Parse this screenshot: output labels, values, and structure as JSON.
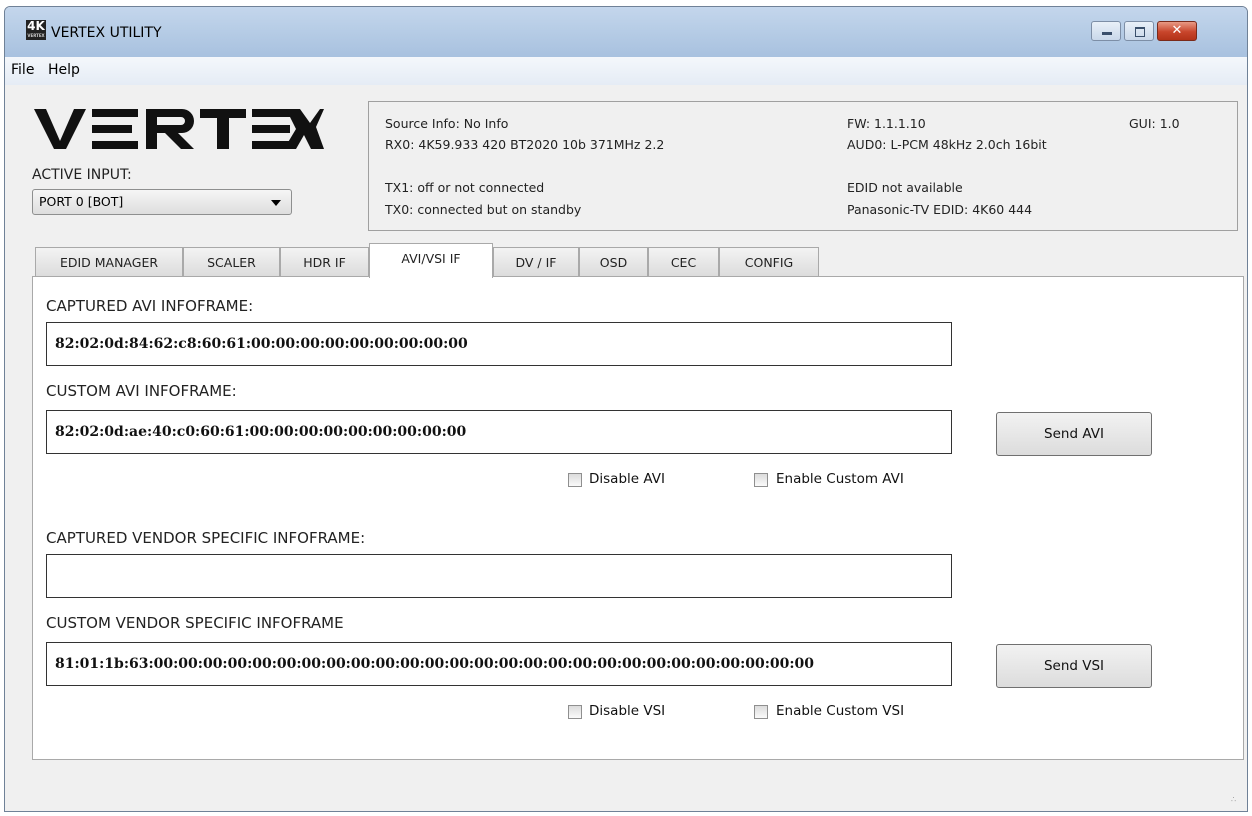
{
  "window": {
    "title": "VERTEX UTILITY",
    "app_icon": "4K-icon"
  },
  "menu": {
    "file": "File",
    "help": "Help"
  },
  "logo": {
    "text": "VERTEX"
  },
  "active_input": {
    "label": "ACTIVE INPUT:",
    "value": "PORT 0 [BOT]"
  },
  "info": {
    "source": "Source Info: No Info",
    "rx0": "RX0: 4K59.933 420 BT2020 10b 371MHz 2.2",
    "tx1": "TX1: off or not connected",
    "tx0": "TX0: connected but on standby",
    "fw": "FW: 1.1.1.10",
    "gui": "GUI: 1.0",
    "aud0": "AUD0: L-PCM 48kHz 2.0ch 16bit",
    "edid_status": "EDID not available",
    "edid_tv": "Panasonic-TV EDID: 4K60 444"
  },
  "tabs": [
    "EDID MANAGER",
    "SCALER",
    "HDR IF",
    "AVI/VSI IF",
    "DV / IF",
    "OSD",
    "CEC",
    "CONFIG"
  ],
  "panel": {
    "captured_avi_label": "CAPTURED AVI INFOFRAME:",
    "captured_avi_value": "82:02:0d:84:62:c8:60:61:00:00:00:00:00:00:00:00:00",
    "custom_avi_label": "CUSTOM AVI INFOFRAME:",
    "custom_avi_value": "82:02:0d:ae:40:c0:60:61:00:00:00:00:00:00:00:00:00",
    "send_avi": "Send AVI",
    "disable_avi": "Disable AVI",
    "enable_custom_avi": "Enable Custom AVI",
    "captured_vsi_label": "CAPTURED VENDOR SPECIFIC INFOFRAME:",
    "captured_vsi_value": "",
    "custom_vsi_label": "CUSTOM VENDOR SPECIFIC INFOFRAME",
    "custom_vsi_value": "81:01:1b:63:00:00:00:00:00:00:00:00:00:00:00:00:00:00:00:00:00:00:00:00:00:00:00:00:00:00:00",
    "send_vsi": "Send VSI",
    "disable_vsi": "Disable VSI",
    "enable_custom_vsi": "Enable Custom VSI"
  }
}
